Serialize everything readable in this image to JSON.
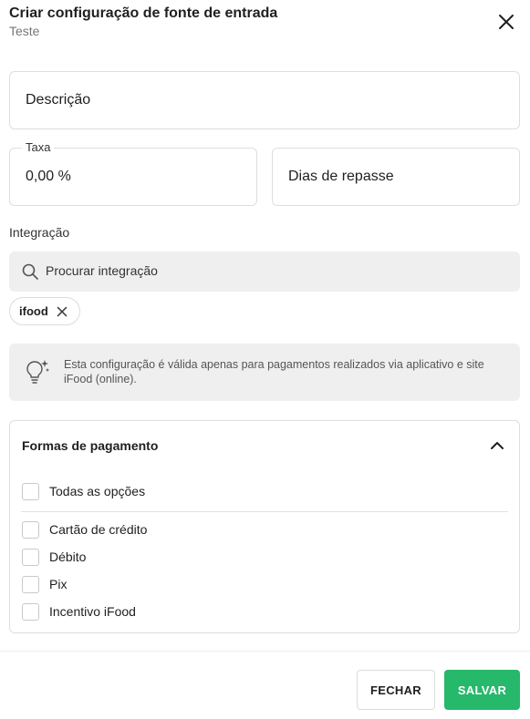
{
  "header": {
    "title": "Criar configuração de fonte de entrada",
    "subtitle": "Teste"
  },
  "icons": {
    "close": "close-icon",
    "search": "search-icon",
    "chip_remove": "close-icon",
    "info": "lightbulb-sparkle-icon",
    "collapse": "chevron-up-icon"
  },
  "form": {
    "descricao": {
      "placeholder": "Descrição"
    },
    "taxa": {
      "label": "Taxa",
      "value": "0,00 %"
    },
    "dias_repasse": {
      "placeholder": "Dias de repasse"
    }
  },
  "integracao": {
    "label": "Integração",
    "search_placeholder": "Procurar integração",
    "selected_chips": [
      {
        "label": "ifood"
      }
    ],
    "info_text": "Esta configuração é válida apenas para pagamentos realizados via aplicativo e site iFood (online)."
  },
  "payments": {
    "title": "Formas de pagamento",
    "expanded": true,
    "all_option": {
      "label": "Todas as opções",
      "checked": false
    },
    "options": [
      {
        "label": "Cartão de crédito",
        "checked": false
      },
      {
        "label": "Débito",
        "checked": false
      },
      {
        "label": "Pix",
        "checked": false
      },
      {
        "label": "Incentivo iFood",
        "checked": false
      }
    ]
  },
  "footer": {
    "close_label": "FECHAR",
    "save_label": "SALVAR"
  },
  "colors": {
    "primary_green": "#26b86b",
    "surface_grey": "#efefef",
    "border": "#dedede"
  }
}
